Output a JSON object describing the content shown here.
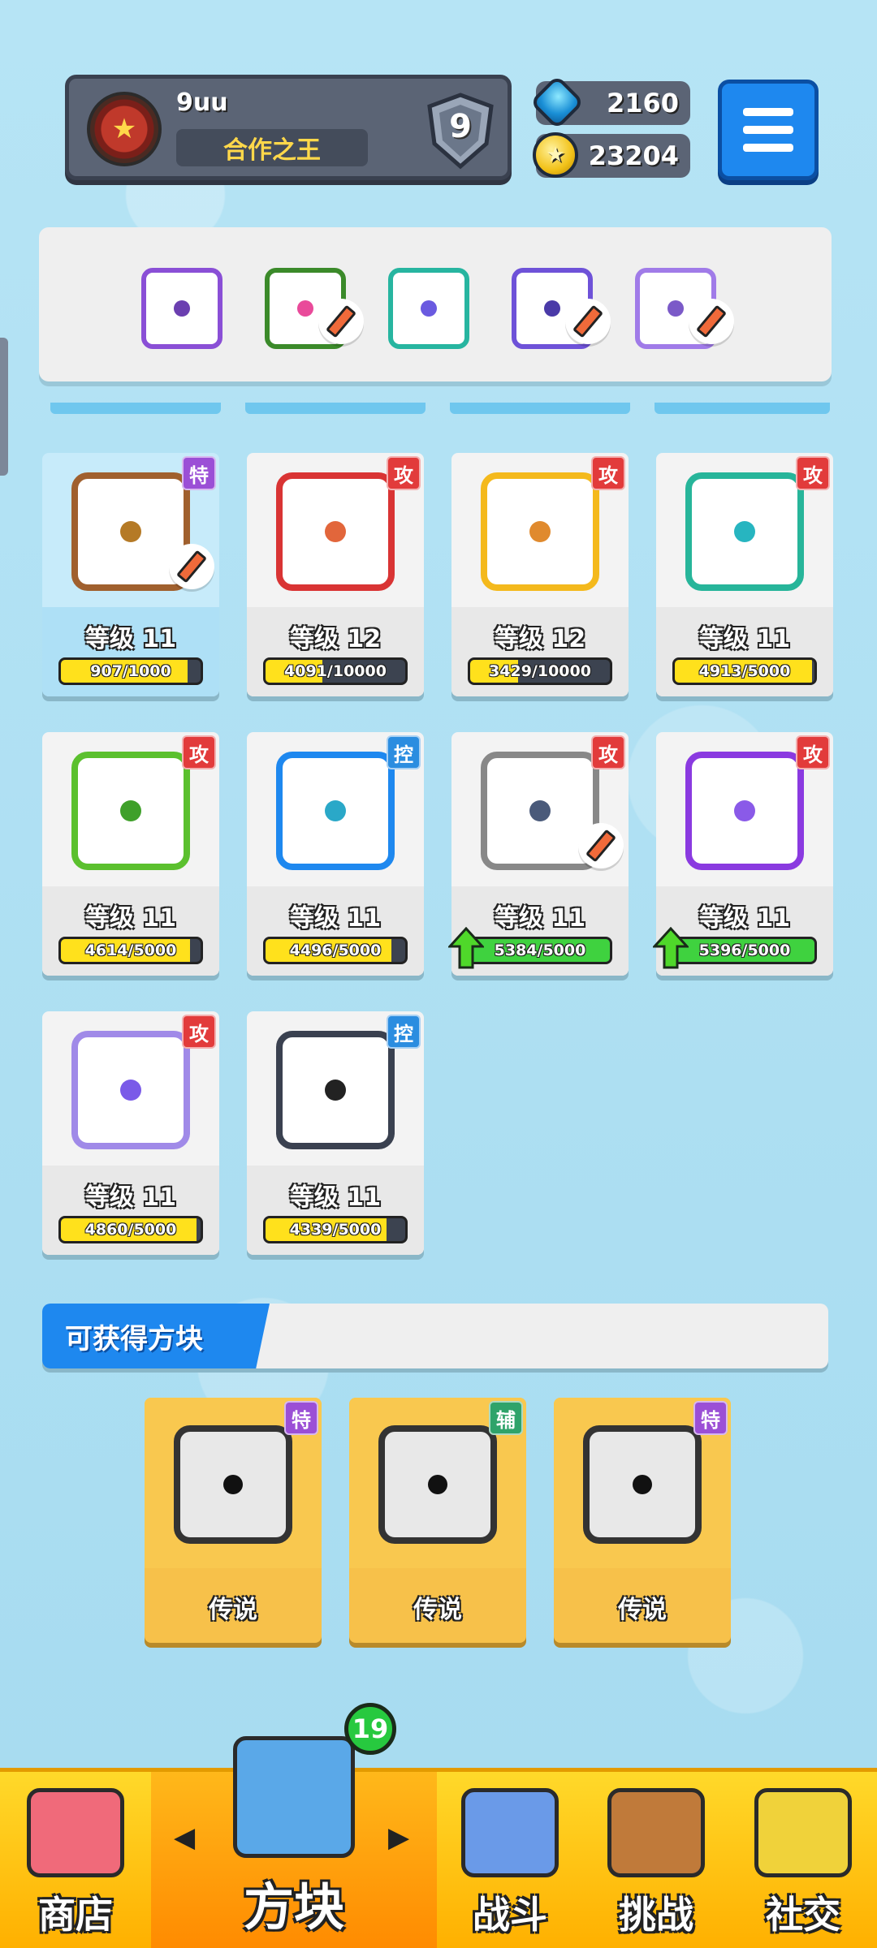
{
  "player": {
    "name": "9uu",
    "title": "合作之王",
    "rank": "9"
  },
  "currency": {
    "gems": "2160",
    "coins": "23204"
  },
  "deck": [
    {
      "color": "#8a4fd6",
      "dot": "#6b3fb0",
      "icon": "saw-icon",
      "pencil": false
    },
    {
      "color": "#3b8a2a",
      "dot": "#e94a9a",
      "icon": "rainbow-icon",
      "pencil": true
    },
    {
      "color": "#27b5a0",
      "dot": "#6a5ae0",
      "icon": "hands-icon",
      "pencil": false
    },
    {
      "color": "#6e52d8",
      "dot": "#4a3aa8",
      "icon": "dragon-icon",
      "pencil": true
    },
    {
      "color": "#a07be8",
      "dot": "#7b5ac8",
      "icon": "crack-icon",
      "pencil": true
    }
  ],
  "dice": [
    {
      "tag": "特",
      "tag_color": "purple",
      "border": "#a0602e",
      "dot": "#b57a26",
      "level": "等级 11",
      "progress": "907/1000",
      "fill": 0.907,
      "bar": "yellow",
      "highlight": true,
      "pencil": true,
      "upgrade": false
    },
    {
      "tag": "攻",
      "tag_color": "red",
      "border": "#d93434",
      "dot": "#e2663b",
      "level": "等级 12",
      "progress": "4091/10000",
      "fill": 0.409,
      "bar": "yellow",
      "highlight": false,
      "pencil": false,
      "upgrade": false
    },
    {
      "tag": "攻",
      "tag_color": "red",
      "border": "#f4b91c",
      "dot": "#e08a2e",
      "level": "等级 12",
      "progress": "3429/10000",
      "fill": 0.343,
      "bar": "yellow",
      "highlight": false,
      "pencil": false,
      "upgrade": false
    },
    {
      "tag": "攻",
      "tag_color": "red",
      "border": "#27b59a",
      "dot": "#27b5c0",
      "level": "等级 11",
      "progress": "4913/5000",
      "fill": 0.983,
      "bar": "yellow",
      "highlight": false,
      "pencil": false,
      "upgrade": false
    },
    {
      "tag": "攻",
      "tag_color": "red",
      "border": "#5bc02e",
      "dot": "#3fa02a",
      "level": "等级 11",
      "progress": "4614/5000",
      "fill": 0.923,
      "bar": "yellow",
      "highlight": false,
      "pencil": false,
      "upgrade": false
    },
    {
      "tag": "控",
      "tag_color": "blue",
      "border": "#1e88ef",
      "dot": "#2aa8c8",
      "level": "等级 11",
      "progress": "4496/5000",
      "fill": 0.899,
      "bar": "yellow",
      "highlight": false,
      "pencil": false,
      "upgrade": false
    },
    {
      "tag": "攻",
      "tag_color": "red",
      "border": "#888888",
      "dot": "#4a5a7a",
      "level": "等级 11",
      "progress": "5384/5000",
      "fill": 1.0,
      "bar": "green",
      "highlight": false,
      "pencil": true,
      "upgrade": true
    },
    {
      "tag": "攻",
      "tag_color": "red",
      "border": "#8a3ae0",
      "dot": "#8a5ae8",
      "level": "等级 11",
      "progress": "5396/5000",
      "fill": 1.0,
      "bar": "green",
      "highlight": false,
      "pencil": false,
      "upgrade": true
    },
    {
      "tag": "攻",
      "tag_color": "red",
      "border": "#a08ae8",
      "dot": "#7a5ae8",
      "level": "等级 11",
      "progress": "4860/5000",
      "fill": 0.972,
      "bar": "yellow",
      "highlight": false,
      "pencil": false,
      "upgrade": false
    },
    {
      "tag": "控",
      "tag_color": "blue",
      "border": "#3a4150",
      "dot": "#222222",
      "level": "等级 11",
      "progress": "4339/5000",
      "fill": 0.868,
      "bar": "yellow",
      "highlight": false,
      "pencil": false,
      "upgrade": false
    }
  ],
  "obtainable": {
    "title": "可获得方块",
    "items": [
      {
        "tag": "特",
        "tag_color": "purple",
        "rarity": "传说",
        "icon": "chain-dragon-icon"
      },
      {
        "tag": "辅",
        "tag_color": "green",
        "rarity": "传说",
        "icon": "target-dragon-icon"
      },
      {
        "tag": "特",
        "tag_color": "purple",
        "rarity": "传说",
        "icon": "storm-dragon-icon"
      }
    ]
  },
  "nav": {
    "badge": "19",
    "items": [
      {
        "label": "商店",
        "icon": "shop-icon"
      },
      {
        "label": "方块",
        "icon": "dice-box-icon"
      },
      {
        "label": "战斗",
        "icon": "battle-icon"
      },
      {
        "label": "挑战",
        "icon": "challenge-icon"
      },
      {
        "label": "社交",
        "icon": "social-icon"
      }
    ]
  },
  "colors": {
    "accent": "#1e88ef",
    "nav_bg": "#ffc21a",
    "tag_red": "#e23b3b",
    "tag_purple": "#9b4fd6",
    "tag_blue": "#2b8de0",
    "tag_green": "#2fa36a"
  }
}
